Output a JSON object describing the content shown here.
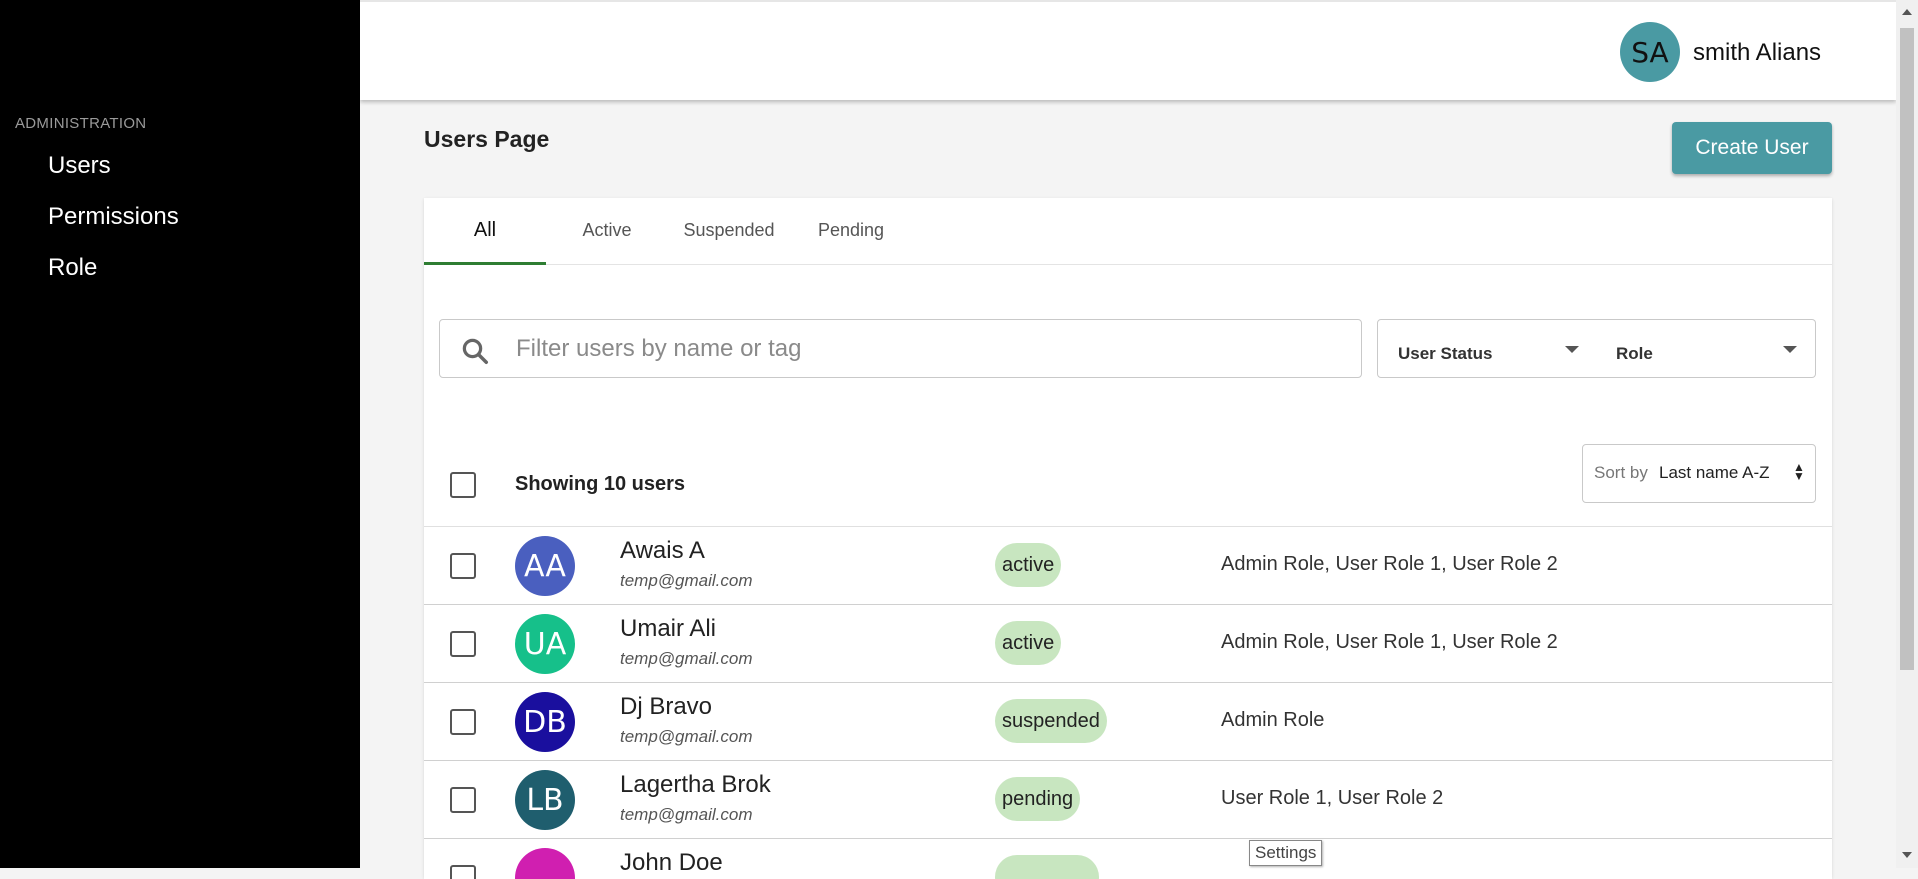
{
  "sidebar": {
    "section_title": "ADMINISTRATION",
    "items": [
      {
        "label": "Users"
      },
      {
        "label": "Permissions"
      },
      {
        "label": "Role"
      }
    ]
  },
  "header": {
    "user_initials": "SA",
    "user_name": "smith Alians"
  },
  "page": {
    "title": "Users Page",
    "create_button": "Create User"
  },
  "tabs": [
    {
      "label": "All",
      "active": true
    },
    {
      "label": "Active"
    },
    {
      "label": "Suspended"
    },
    {
      "label": "Pending"
    }
  ],
  "filters": {
    "search_placeholder": "Filter users by name or tag",
    "search_value": "",
    "status_label": "User Status",
    "role_label": "Role"
  },
  "list": {
    "count_text": "Showing 10 users",
    "sort_label": "Sort by",
    "sort_value": "Last name A-Z"
  },
  "users": [
    {
      "initials": "AA",
      "name": "Awais A",
      "email": "temp@gmail.com",
      "status": "active",
      "roles": "Admin Role, User Role 1, User Role 2",
      "avatar_color": "#4a5fbf"
    },
    {
      "initials": "UA",
      "name": "Umair Ali",
      "email": "temp@gmail.com",
      "status": "active",
      "roles": "Admin Role, User Role 1, User Role 2",
      "avatar_color": "#16c08a"
    },
    {
      "initials": "DB",
      "name": "Dj Bravo",
      "email": "temp@gmail.com",
      "status": "suspended",
      "roles": "Admin Role",
      "avatar_color": "#1a0f9e"
    },
    {
      "initials": "LB",
      "name": "Lagertha Brok",
      "email": "temp@gmail.com",
      "status": "pending",
      "roles": "User Role 1, User Role 2",
      "avatar_color": "#1f5e6e"
    },
    {
      "initials": "",
      "name": "John Doe",
      "email": "",
      "status": "",
      "roles": "",
      "avatar_color": "#d01fb0"
    }
  ],
  "tooltip": "Settings",
  "colors": {
    "accent": "#4a9aa3",
    "active_tab": "#2e7d32",
    "badge": "#c8e6c0"
  }
}
